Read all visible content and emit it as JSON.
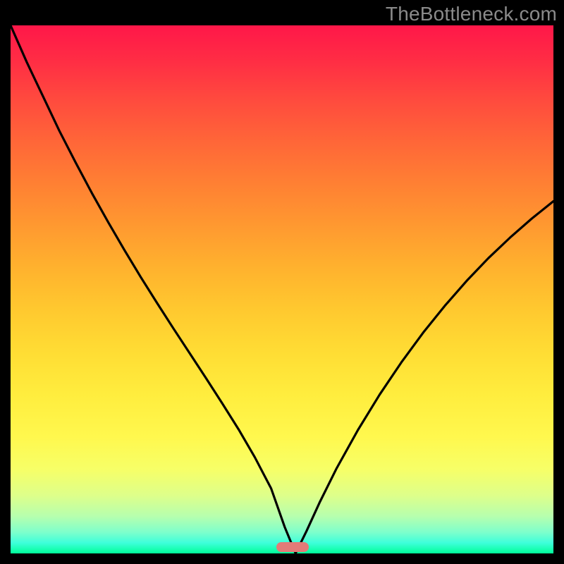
{
  "watermark": "TheBottleneck.com",
  "chart_data": {
    "type": "line",
    "title": "",
    "xlabel": "",
    "ylabel": "",
    "xlim": [
      0,
      100
    ],
    "ylim": [
      0,
      100
    ],
    "grid": false,
    "legend": false,
    "series": [
      {
        "name": "left-branch",
        "x": [
          0,
          3,
          6,
          9,
          12,
          15,
          18,
          21,
          24,
          27,
          30,
          33,
          36,
          39,
          42,
          45,
          48,
          50.5,
          52.5
        ],
        "values": [
          100,
          93,
          86.5,
          80,
          74,
          68.2,
          62.7,
          57.4,
          52.3,
          47.4,
          42.6,
          37.9,
          33.2,
          28.4,
          23.5,
          18.2,
          12.3,
          5.0,
          0
        ]
      },
      {
        "name": "right-branch",
        "x": [
          52.5,
          54.5,
          57,
          60,
          64,
          68,
          72,
          76,
          80,
          84,
          88,
          92,
          96,
          100
        ],
        "values": [
          0,
          4.2,
          9.8,
          16.0,
          23.4,
          30.1,
          36.2,
          41.8,
          46.9,
          51.6,
          55.9,
          59.8,
          63.4,
          66.7
        ]
      }
    ],
    "marker": {
      "x_center": 52.0,
      "x_width": 6.0,
      "y": 0.5,
      "color": "#e37b78"
    },
    "background_gradient_stops": [
      {
        "pos": 0,
        "color": "#ff1749"
      },
      {
        "pos": 14,
        "color": "#ff4a3e"
      },
      {
        "pos": 30,
        "color": "#ff8033"
      },
      {
        "pos": 46,
        "color": "#ffb22e"
      },
      {
        "pos": 62,
        "color": "#ffdd34"
      },
      {
        "pos": 78,
        "color": "#fff84e"
      },
      {
        "pos": 89,
        "color": "#deff8a"
      },
      {
        "pos": 96,
        "color": "#7dffcc"
      },
      {
        "pos": 100,
        "color": "#00ff99"
      }
    ]
  }
}
